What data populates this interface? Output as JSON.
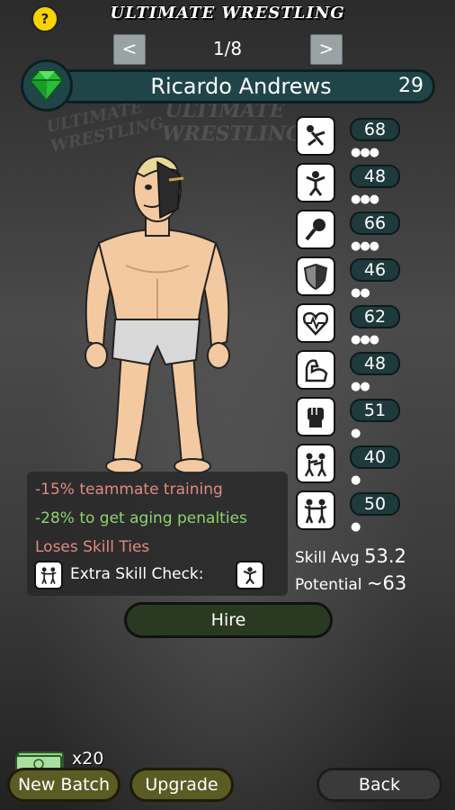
{
  "header": {
    "help_label": "?",
    "title": "ULTIMATE WRESTLING",
    "prev_label": "<",
    "next_label": ">",
    "page_counter": "1/8"
  },
  "background": {
    "banner_text": "ULTIMATE WRESTLING",
    "banner_text_2": "ULTIMATE WRESTLING"
  },
  "wrestler": {
    "name": "Ricardo Andrews",
    "age": "29",
    "gem_color": "#2bbd3a"
  },
  "skills": [
    {
      "icon": "wrestler-falling-icon",
      "value": "68",
      "dots": "●●●"
    },
    {
      "icon": "wrestler-lifting-icon",
      "value": "48",
      "dots": "●●●"
    },
    {
      "icon": "microphone-icon",
      "value": "66",
      "dots": "●●●"
    },
    {
      "icon": "shield-icon",
      "value": "46",
      "dots": "●●"
    },
    {
      "icon": "heart-pulse-icon",
      "value": "62",
      "dots": "●●●"
    },
    {
      "icon": "flexed-arm-icon",
      "value": "48",
      "dots": "●●"
    },
    {
      "icon": "fist-icon",
      "value": "51",
      "dots": "●"
    },
    {
      "icon": "brawling-icon",
      "value": "40",
      "dots": "●"
    },
    {
      "icon": "tag-team-icon",
      "value": "50",
      "dots": "●"
    }
  ],
  "traits": {
    "line1": "-15% teammate training",
    "line2": "-28% to get aging penalties",
    "line3": "Loses Skill Ties",
    "extra_label": "Extra Skill Check:"
  },
  "summary": {
    "skill_avg_label": "Skill Avg",
    "skill_avg_value": "53.2",
    "potential_label": "Potential",
    "potential_value": "~63"
  },
  "actions": {
    "hire_label": "Hire",
    "cash_count": "x20",
    "new_batch_label": "New Batch",
    "upgrade_label": "Upgrade",
    "back_label": "Back"
  },
  "colors": {
    "panel": "#1f4548",
    "positive": "#8ed36f",
    "negative": "#e08a84",
    "help": "#f5d400"
  }
}
